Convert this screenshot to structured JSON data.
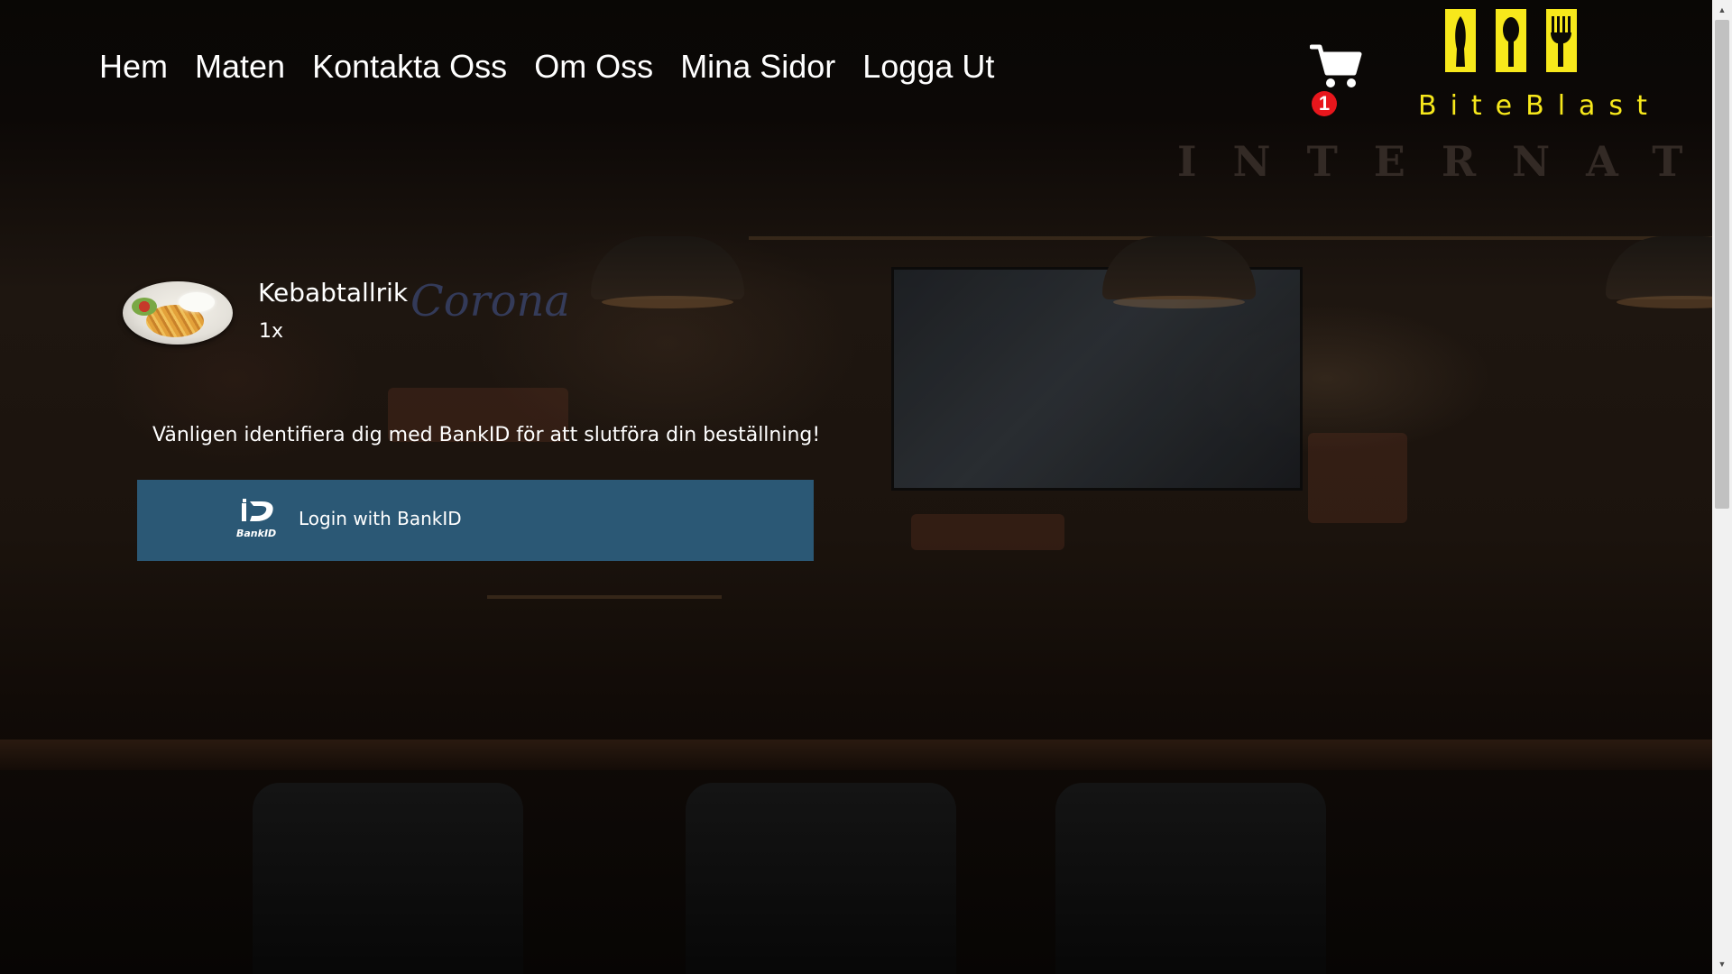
{
  "nav": {
    "items": [
      {
        "label": "Hem"
      },
      {
        "label": "Maten"
      },
      {
        "label": "Kontakta Oss"
      },
      {
        "label": "Om Oss"
      },
      {
        "label": "Mina Sidor"
      },
      {
        "label": "Logga Ut"
      }
    ]
  },
  "cart": {
    "icon": "cart-icon",
    "count": "1",
    "badge_color": "#e8161c"
  },
  "brand": {
    "name": "BiteBlast",
    "color": "#f7e81b",
    "icon": "knife-spoon-fork-logo"
  },
  "order": {
    "item_name": "Kebabtallrik",
    "item_qty": "1x",
    "item_image": "kebab-plate-photo"
  },
  "checkout": {
    "notice": "Vänligen identifiera dig med BankID för att slutföra din beställning!",
    "bankid_button_label": "Login with BankID",
    "bankid_button_color": "#2b5875",
    "bankid_logo_text": "BankID"
  }
}
